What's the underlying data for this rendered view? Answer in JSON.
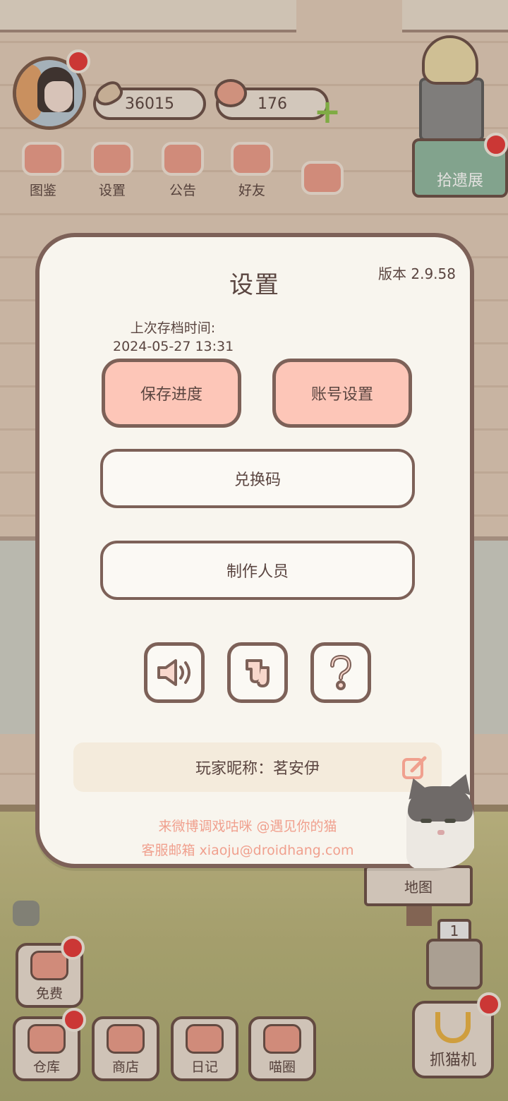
{
  "hud": {
    "fish_count": "36015",
    "heart_count": "176"
  },
  "top_menu": [
    {
      "label": "图鉴"
    },
    {
      "label": "设置"
    },
    {
      "label": "公告"
    },
    {
      "label": "好友"
    },
    {
      "label": ""
    }
  ],
  "exhibit": {
    "label": "拾遗展"
  },
  "dialog": {
    "title": "设置",
    "version": "版本 2.9.58",
    "last_save_label": "上次存档时间:",
    "last_save_time": "2024-05-27 13:31",
    "save_button": "保存进度",
    "account_button": "账号设置",
    "redeem_button": "兑换码",
    "credits_button": "制作人员",
    "icons": [
      "speaker-icon",
      "music-note-icon",
      "question-icon"
    ],
    "nickname_label": "玩家昵称：茗安伊",
    "footer_weibo": "来微博调戏咕咪 @遇见你的猫",
    "footer_email": "客服邮箱 xiaoju@droidhang.com"
  },
  "map_sign": {
    "label": "地图"
  },
  "elevator": {
    "floor": "1"
  },
  "bottom_menu": {
    "free": "免费",
    "warehouse": "仓库",
    "shop": "商店",
    "diary": "日记",
    "meow_circle": "喵圈",
    "claw_machine": "抓猫机"
  },
  "colors": {
    "dialog_bg": "#f8f5ee",
    "dialog_border": "#7d6158",
    "pink_button": "#fdc6b8",
    "footer_text": "#f0a08e",
    "notification": "#e33a3a"
  }
}
